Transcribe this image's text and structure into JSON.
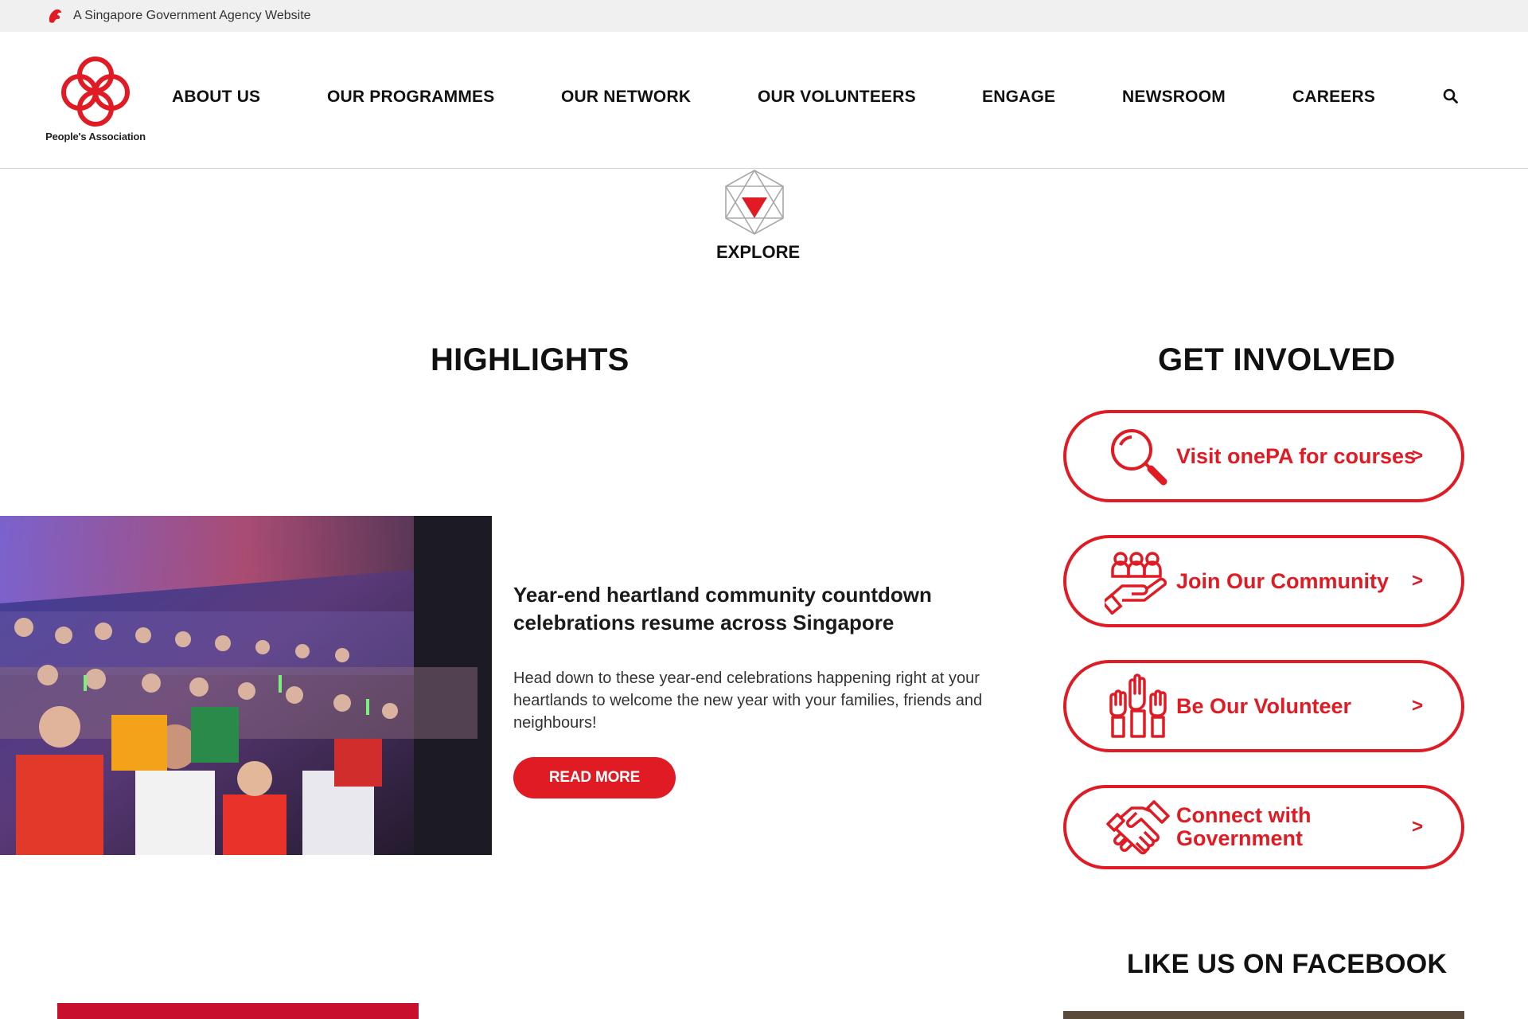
{
  "gov_bar": {
    "text": "A Singapore Government Agency Website"
  },
  "logo": {
    "text": "People's Association"
  },
  "nav": {
    "items": [
      {
        "label": "ABOUT US"
      },
      {
        "label": "OUR PROGRAMMES"
      },
      {
        "label": "OUR NETWORK"
      },
      {
        "label": "OUR VOLUNTEERS"
      },
      {
        "label": "ENGAGE"
      },
      {
        "label": "NEWSROOM"
      },
      {
        "label": "CAREERS"
      }
    ]
  },
  "explore": {
    "label": "EXPLORE"
  },
  "highlights": {
    "title": "HIGHLIGHTS",
    "item": {
      "title": "Year-end heartland community countdown celebrations resume across Singapore",
      "description": "Head down to these year-end celebrations happening right at your heartlands to welcome the new year with your families, friends and neighbours!",
      "button": "READ MORE"
    }
  },
  "get_involved": {
    "title": "GET INVOLVED",
    "buttons": [
      {
        "label": "Visit onePA for courses",
        "arrow": ">",
        "icon": "magnifier-icon"
      },
      {
        "label": "Join Our Community",
        "arrow": ">",
        "icon": "community-hand-icon"
      },
      {
        "label": "Be Our Volunteer",
        "arrow": ">",
        "icon": "raised-hands-icon"
      },
      {
        "label": "Connect with Government",
        "arrow": ">",
        "icon": "handshake-icon"
      }
    ]
  },
  "facebook": {
    "title": "LIKE US ON FACEBOOK"
  },
  "colors": {
    "brand_red": "#e01b24",
    "text_dark": "#111111",
    "gov_bar_bg": "#f0f0f0"
  }
}
